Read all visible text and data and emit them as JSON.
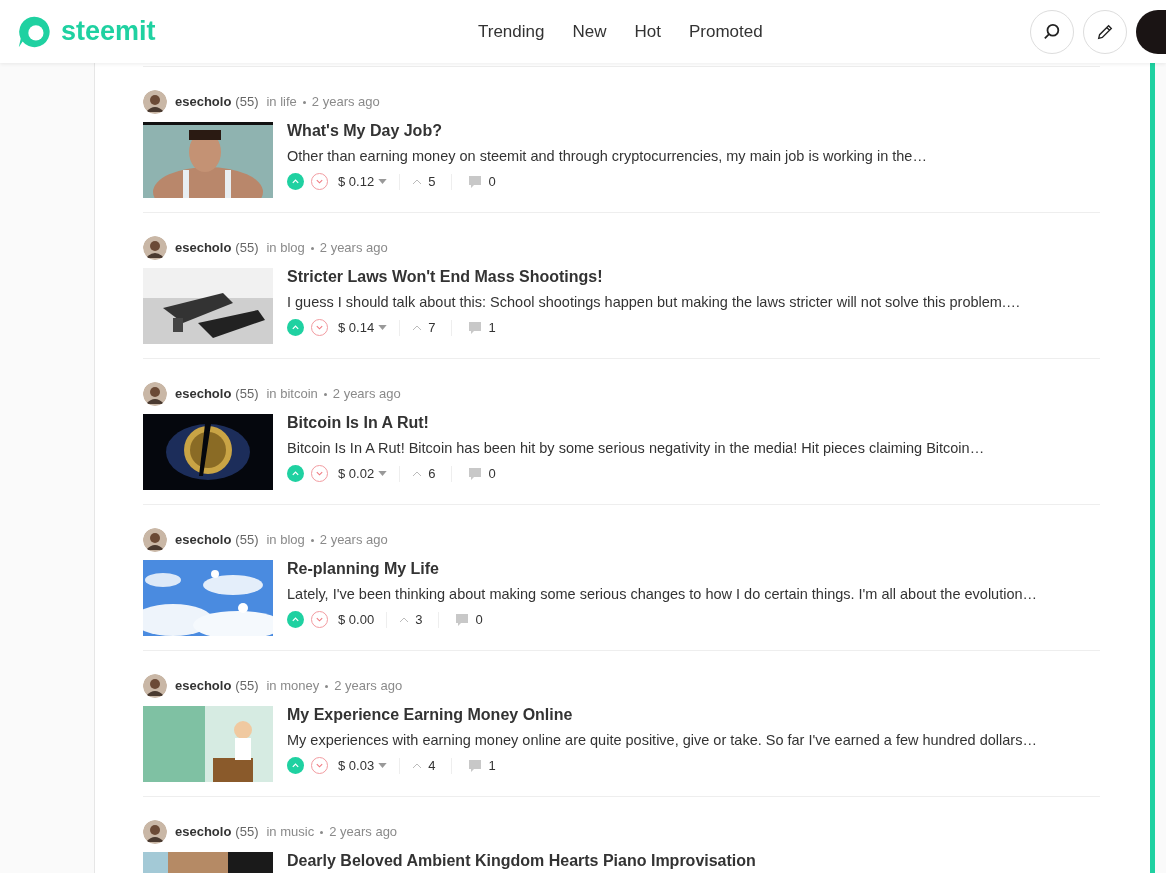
{
  "header": {
    "logo": "steemit",
    "nav": [
      {
        "label": "Trending"
      },
      {
        "label": "New"
      },
      {
        "label": "Hot"
      },
      {
        "label": "Promoted"
      }
    ]
  },
  "posts": [
    {
      "author": "esecholo",
      "reputation": "(55)",
      "category": "in life",
      "time": "2 years ago",
      "title": "What's My Day Job?",
      "excerpt": "Other than earning money on steemit and through cryptocurrencies, my main job is working in the…",
      "payout": "$ 0.12",
      "payout_menu": true,
      "votes": "5",
      "comments": "0"
    },
    {
      "author": "esecholo",
      "reputation": "(55)",
      "category": "in blog",
      "time": "2 years ago",
      "title": "Stricter Laws Won't End Mass Shootings!",
      "excerpt": "I guess I should talk about this: School shootings happen but making the laws stricter will not solve this problem.…",
      "payout": "$ 0.14",
      "payout_menu": true,
      "votes": "7",
      "comments": "1"
    },
    {
      "author": "esecholo",
      "reputation": "(55)",
      "category": "in bitcoin",
      "time": "2 years ago",
      "title": "Bitcoin Is In A Rut!",
      "excerpt": "Bitcoin Is In A Rut! Bitcoin has been hit by some serious negativity in the media! Hit pieces claiming Bitcoin…",
      "payout": "$ 0.02",
      "payout_menu": true,
      "votes": "6",
      "comments": "0"
    },
    {
      "author": "esecholo",
      "reputation": "(55)",
      "category": "in blog",
      "time": "2 years ago",
      "title": "Re-planning My Life",
      "excerpt": "Lately, I've been thinking about making some serious changes to how I do certain things. I'm all about the evolution…",
      "payout": "$ 0.00",
      "payout_menu": false,
      "votes": "3",
      "comments": "0"
    },
    {
      "author": "esecholo",
      "reputation": "(55)",
      "category": "in money",
      "time": "2 years ago",
      "title": "My Experience Earning Money Online",
      "excerpt": "My experiences with earning money online are quite positive, give or take. So far I've earned a few hundred dollars…",
      "payout": "$ 0.03",
      "payout_menu": true,
      "votes": "4",
      "comments": "1"
    },
    {
      "author": "esecholo",
      "reputation": "(55)",
      "category": "in music",
      "time": "2 years ago",
      "title": "Dearly Beloved Ambient Kingdom Hearts Piano Improvisation"
    }
  ]
}
